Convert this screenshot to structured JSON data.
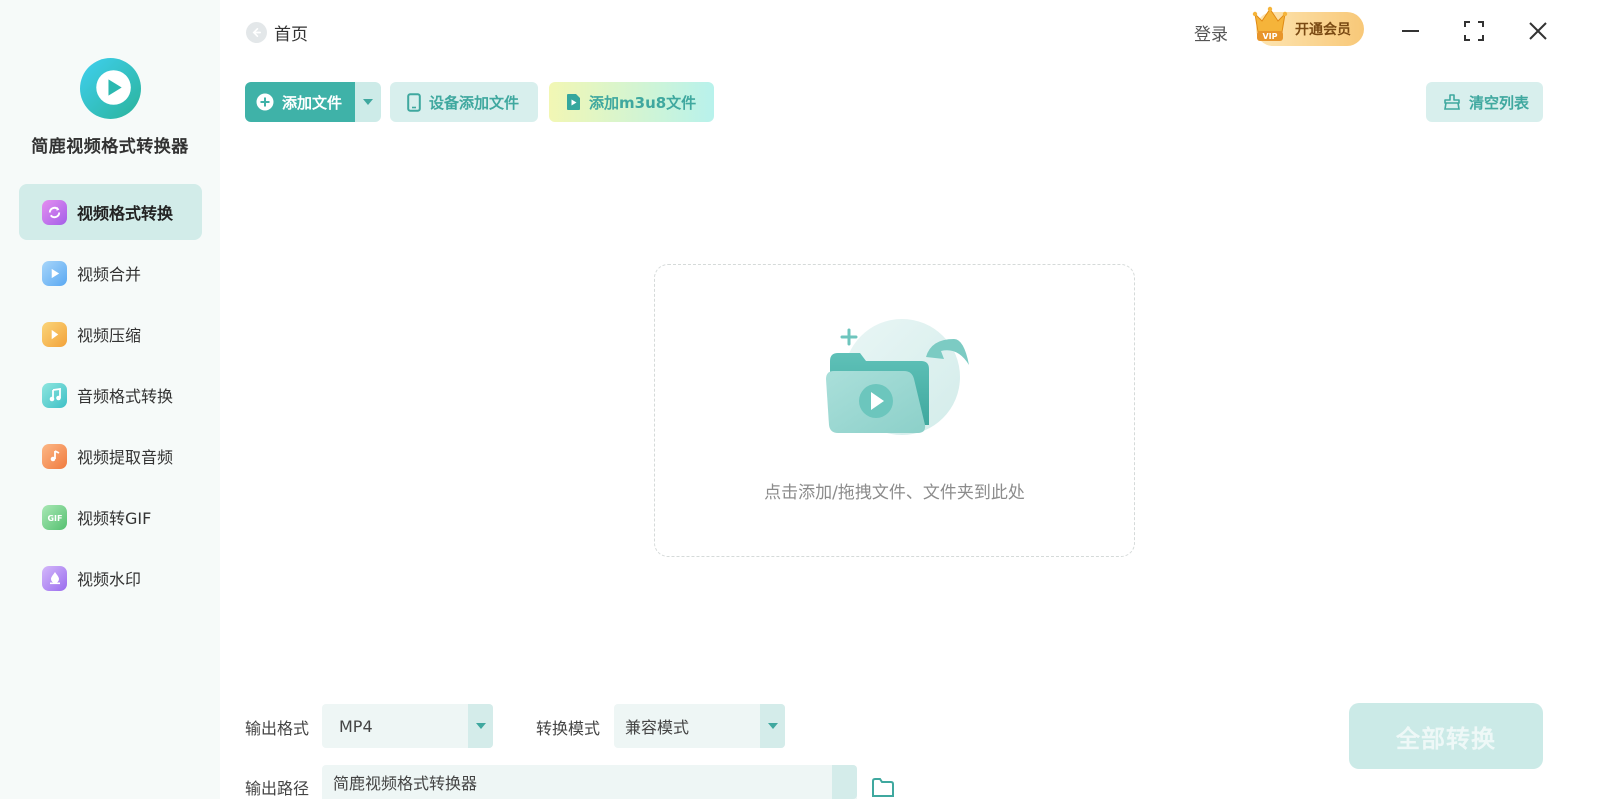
{
  "sidebar": {
    "app_name": "简鹿视频格式转换器",
    "items": [
      {
        "label": "视频格式转换",
        "icon": "video-convert-icon",
        "color": "#c56ef0",
        "active": true
      },
      {
        "label": "视频合并",
        "icon": "video-merge-icon",
        "color": "#6fb5f5"
      },
      {
        "label": "视频压缩",
        "icon": "video-compress-icon",
        "color": "#f5b84a"
      },
      {
        "label": "音频格式转换",
        "icon": "audio-convert-icon",
        "color": "#5ccfd0"
      },
      {
        "label": "视频提取音频",
        "icon": "extract-audio-icon",
        "color": "#f59a5a"
      },
      {
        "label": "视频转GIF",
        "icon": "gif-icon",
        "color": "#7bd08a"
      },
      {
        "label": "视频水印",
        "icon": "watermark-icon",
        "color": "#b58cf2"
      }
    ]
  },
  "header": {
    "back_label": "首页",
    "login_label": "登录",
    "vip_label": "开通会员",
    "vip_badge": "VIP"
  },
  "toolbar": {
    "add_file_label": "添加文件",
    "device_add_label": "设备添加文件",
    "m3u8_add_label": "添加m3u8文件",
    "clear_list_label": "清空列表"
  },
  "dropzone": {
    "hint": "点击添加/拖拽文件、文件夹到此处"
  },
  "bottom": {
    "output_format_label": "输出格式",
    "output_format_value": "MP4",
    "convert_mode_label": "转换模式",
    "convert_mode_value": "兼容模式",
    "output_path_label": "输出路径",
    "output_path_value": "简鹿视频格式转换器",
    "convert_all_label": "全部转换"
  },
  "colors": {
    "accent": "#3fb2a8",
    "sidebar_bg": "#f6faf9",
    "active_item_bg": "#d2ece9"
  }
}
